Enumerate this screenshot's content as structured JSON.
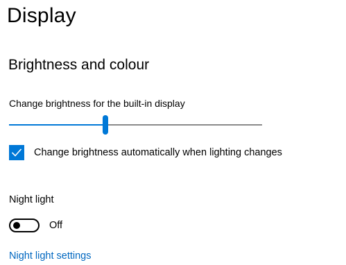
{
  "page": {
    "title": "Display"
  },
  "brightness_section": {
    "heading": "Brightness and colour",
    "slider_label": "Change brightness for the built-in display",
    "slider_value_percent": 38,
    "auto_brightness_label": "Change brightness automatically when lighting changes",
    "auto_brightness_checked": true
  },
  "night_light": {
    "label": "Night light",
    "toggle_state": "Off",
    "toggle_on": false,
    "settings_link": "Night light settings"
  },
  "colors": {
    "accent": "#0078d7",
    "link": "#0067c0",
    "track": "#8a8a8a",
    "text": "#000000",
    "background": "#ffffff"
  }
}
